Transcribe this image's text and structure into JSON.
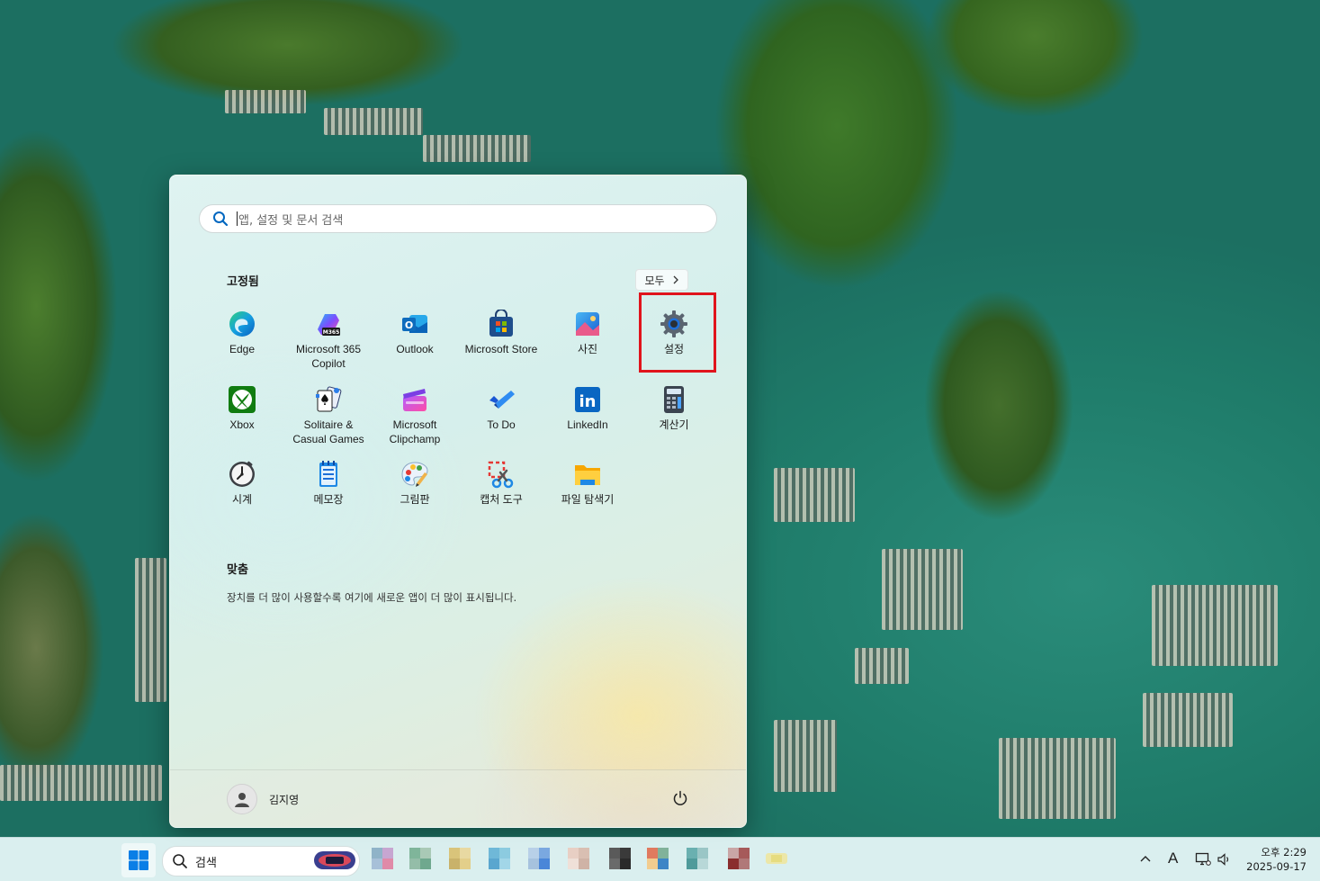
{
  "search": {
    "placeholder": "앱, 설정 및 문서 검색"
  },
  "pinned": {
    "title": "고정됨",
    "all_button": "모두",
    "apps": [
      {
        "name": "Edge",
        "icon": "edge-icon"
      },
      {
        "name": "Microsoft 365 Copilot",
        "icon": "m365-copilot-icon",
        "badge": "M365"
      },
      {
        "name": "Outlook",
        "icon": "outlook-icon",
        "badge": "O"
      },
      {
        "name": "Microsoft Store",
        "icon": "store-icon"
      },
      {
        "name": "사진",
        "icon": "photos-icon"
      },
      {
        "name": "설정",
        "icon": "gear-icon"
      },
      {
        "name": "Xbox",
        "icon": "xbox-icon"
      },
      {
        "name": "Solitaire & Casual Games",
        "icon": "solitaire-icon"
      },
      {
        "name": "Microsoft Clipchamp",
        "icon": "clipchamp-icon"
      },
      {
        "name": "To Do",
        "icon": "todo-icon"
      },
      {
        "name": "LinkedIn",
        "icon": "linkedin-icon",
        "badge": "in"
      },
      {
        "name": "계산기",
        "icon": "calculator-icon"
      },
      {
        "name": "시계",
        "icon": "clock-icon"
      },
      {
        "name": "메모장",
        "icon": "notepad-icon"
      },
      {
        "name": "그림판",
        "icon": "paint-icon"
      },
      {
        "name": "캡처 도구",
        "icon": "snipping-tool-icon"
      },
      {
        "name": "파일 탐색기",
        "icon": "file-explorer-icon"
      }
    ]
  },
  "recommended": {
    "title": "맞춤",
    "text": "장치를 더 많이 사용할수록 여기에 새로운 앱이 더 많이 표시됩니다."
  },
  "user": {
    "name": "김지영"
  },
  "taskbar": {
    "search_label": "검색",
    "clock_time": "오후 2:29",
    "clock_date": "2025-09-17",
    "ime": "A",
    "accent": "#0078d4"
  }
}
